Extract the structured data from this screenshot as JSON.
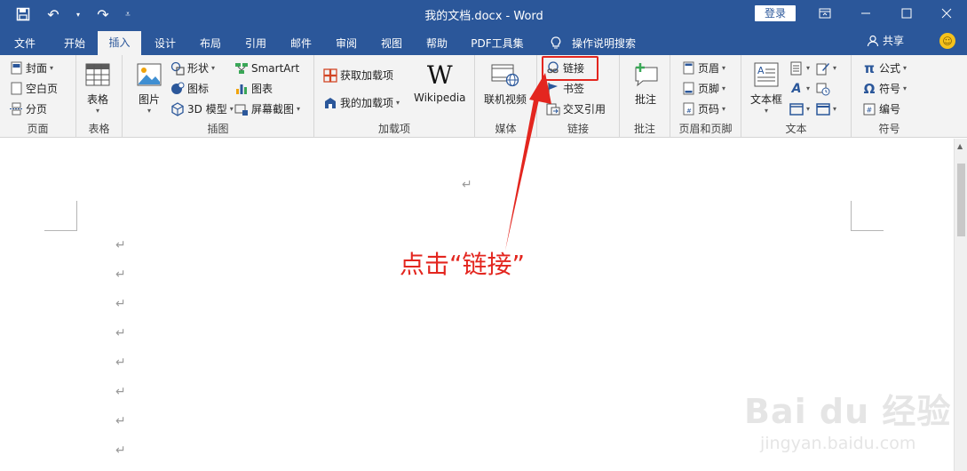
{
  "window": {
    "title": "我的文档.docx  -  Word",
    "login_label": "登录"
  },
  "tabs": [
    "文件",
    "开始",
    "插入",
    "设计",
    "布局",
    "引用",
    "邮件",
    "审阅",
    "视图",
    "帮助",
    "PDF工具集",
    "操作说明搜索"
  ],
  "active_tab": "插入",
  "share_label": "共享",
  "ribbon": {
    "pages": {
      "label": "页面",
      "cover": "封面",
      "blank": "空白页",
      "break": "分页"
    },
    "tables": {
      "label": "表格",
      "table": "表格"
    },
    "illustrations": {
      "label": "插图",
      "picture": "图片",
      "shapes": "形状",
      "icons": "图标",
      "model3d": "3D 模型",
      "smartart": "SmartArt",
      "chart": "图表",
      "screenshot": "屏幕截图"
    },
    "addins": {
      "label": "加载项",
      "get": "获取加载项",
      "mine": "我的加载项",
      "wiki": "Wikipedia"
    },
    "media": {
      "label": "媒体",
      "video": "联机视频"
    },
    "links": {
      "label": "链接",
      "link": "链接",
      "bookmark": "书签",
      "crossref": "交叉引用"
    },
    "comments": {
      "label": "批注",
      "comment": "批注"
    },
    "header_footer": {
      "label": "页眉和页脚",
      "header": "页眉",
      "footer": "页脚",
      "page_number": "页码"
    },
    "text": {
      "label": "文本",
      "textbox": "文本框"
    },
    "symbols": {
      "label": "符号",
      "equation": "公式",
      "symbol": "符号",
      "number": "编号"
    }
  },
  "annotation": {
    "text": "点击“链接”"
  },
  "watermark": {
    "main": "Bai du 经验",
    "sub": "jingyan.baidu.com"
  },
  "colors": {
    "brand": "#2b579a",
    "annotation": "#e3261f"
  }
}
